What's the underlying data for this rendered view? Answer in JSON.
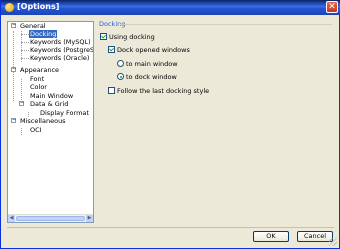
{
  "window": {
    "title": "[Options]"
  },
  "tree": {
    "items": [
      {
        "label": "General"
      },
      {
        "label": "Docking"
      },
      {
        "label": "Keywords (MySQL)"
      },
      {
        "label": "Keywords (PostgreSQL)"
      },
      {
        "label": "Keywords (Oracle)"
      },
      {
        "label": "Appearance"
      },
      {
        "label": "Font"
      },
      {
        "label": "Color"
      },
      {
        "label": "Main Window"
      },
      {
        "label": "Data & Grid"
      },
      {
        "label": "Display Format"
      },
      {
        "label": "Miscellaneous"
      },
      {
        "label": "OCI"
      }
    ]
  },
  "docking": {
    "group_title": "Docking",
    "using_docking": {
      "label": "Using docking",
      "checked": true
    },
    "dock_opened_windows": {
      "label": "Dock opened windows",
      "checked": true
    },
    "to_main_window": {
      "label": "to main window",
      "checked": false
    },
    "to_dock_window": {
      "label": "to dock window",
      "checked": true
    },
    "follow_last_style": {
      "label": "Follow the last docking style",
      "checked": false
    }
  },
  "buttons": {
    "ok": "OK",
    "cancel": "Cancel"
  },
  "colors": {
    "titlebar": "#2456d5",
    "selection": "#316ac5",
    "group_title": "#2a5bd7"
  }
}
